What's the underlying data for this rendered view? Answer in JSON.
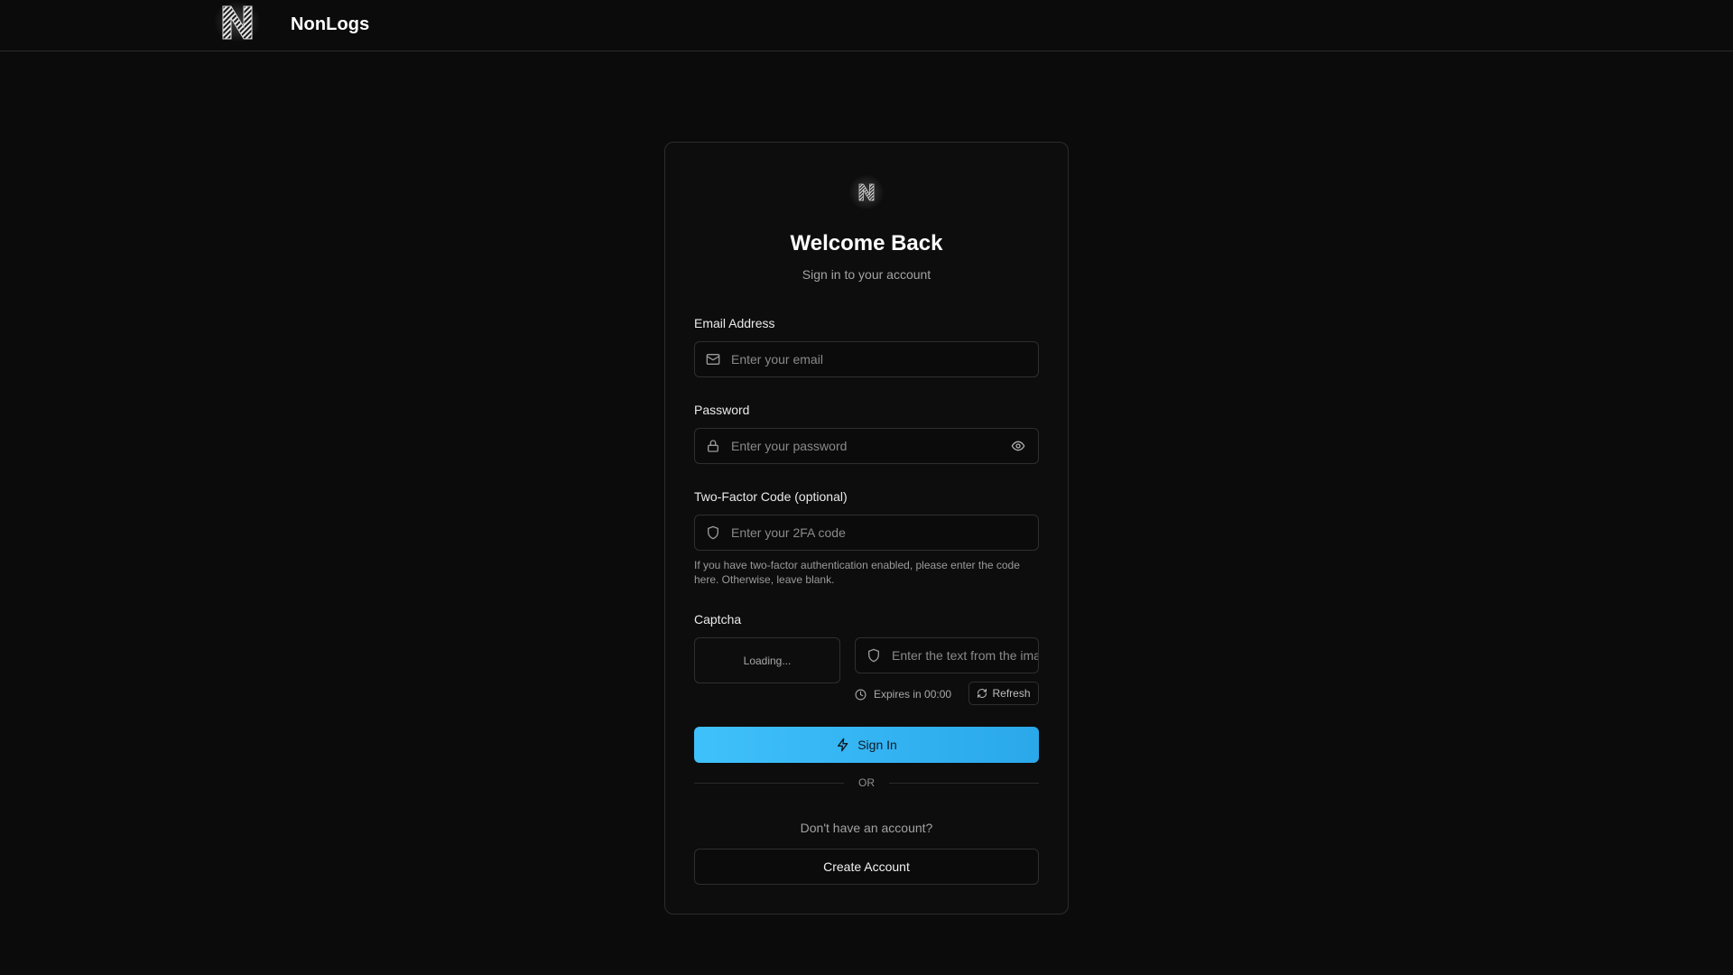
{
  "header": {
    "brand_name": "NonLogs",
    "logo_letter": "N"
  },
  "card": {
    "title": "Welcome Back",
    "subtitle": "Sign in to your account"
  },
  "form": {
    "email": {
      "label": "Email Address",
      "placeholder": "Enter your email",
      "icon": "mail-icon"
    },
    "password": {
      "label": "Password",
      "placeholder": "Enter your password",
      "icon": "lock-icon",
      "toggle_icon": "eye-icon"
    },
    "two_factor": {
      "label": "Two-Factor Code (optional)",
      "placeholder": "Enter your 2FA code",
      "icon": "shield-icon",
      "hint": "If you have two-factor authentication enabled, please enter the code here. Otherwise, leave blank."
    },
    "captcha": {
      "label": "Captcha",
      "image_status": "Loading...",
      "placeholder": "Enter the text from the image",
      "icon": "shield-icon",
      "expires_text": "Expires in 00:00",
      "refresh_label": "Refresh"
    },
    "submit_label": "Sign In",
    "divider_text": "OR",
    "no_account_text": "Don't have an account?",
    "create_account_label": "Create Account"
  },
  "colors": {
    "background": "#0b0b0b",
    "accent": "#38bdf8",
    "border": "#2f2f2f",
    "muted_text": "#a3a3a3"
  }
}
